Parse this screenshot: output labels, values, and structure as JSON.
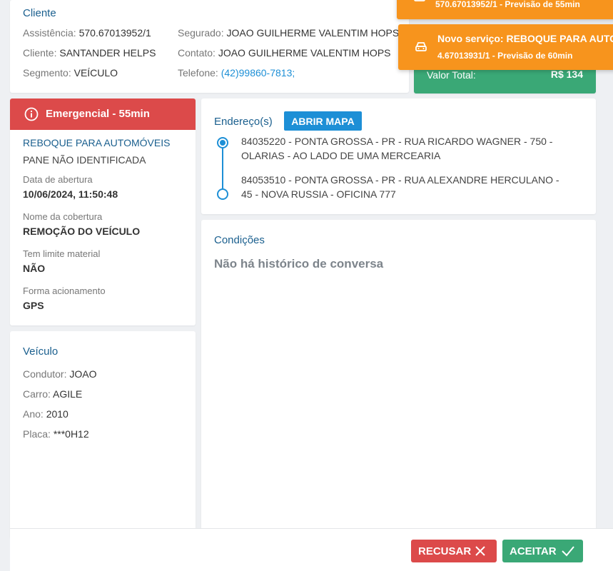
{
  "client": {
    "title": "Cliente",
    "assistencia_label": "Assistência:",
    "assistencia_value": "570.67013952/1",
    "cliente_label": "Cliente:",
    "cliente_value": "SANTANDER HELPS",
    "segmento_label": "Segmento:",
    "segmento_value": "VEÍCULO",
    "segurado_label": "Segurado:",
    "segurado_value": "JOAO GUILHERME VALENTIM HOPS",
    "contato_label": "Contato:",
    "contato_value": "JOAO GUILHERME VALENTIM HOPS",
    "telefone_label": "Telefone:",
    "telefone_value": "(42)99860-7813;"
  },
  "valor": {
    "label": "Valor Total:",
    "value": "R$ 134"
  },
  "notifications": [
    {
      "title": "",
      "subtitle": "570.67013952/1 - Previsão de 55min",
      "icon": "car-icon"
    },
    {
      "title": "Novo serviço: REBOQUE PARA AUTOMÓVEIS",
      "subtitle": "4.67013931/1 - Previsão de 60min",
      "icon": "car-icon"
    }
  ],
  "service": {
    "priority": "Emergencial - 55min",
    "title": "REBOQUE PARA AUTOMÓVEIS",
    "subtitle": "PANE NÃO IDENTIFICADA",
    "fields": [
      {
        "label": "Data de abertura",
        "value": "10/06/2024, 11:50:48"
      },
      {
        "label": "Nome da cobertura",
        "value": "REMOÇÃO DO VEÍCULO"
      },
      {
        "label": "Tem limite material",
        "value": "NÃO"
      },
      {
        "label": "Forma acionamento",
        "value": "GPS"
      }
    ]
  },
  "vehicle": {
    "title": "Veículo",
    "items": [
      {
        "label": "Condutor:",
        "value": "JOAO"
      },
      {
        "label": "Carro:",
        "value": "AGILE"
      },
      {
        "label": "Ano:",
        "value": "2010"
      },
      {
        "label": "Placa:",
        "value": "***0H12"
      }
    ]
  },
  "address": {
    "title": "Endereço(s)",
    "map_button": "ABRIR MAPA",
    "items": [
      "84035220 - PONTA GROSSA - PR - RUA RICARDO WAGNER - 750 - OLARIAS - AO LADO DE UMA MERCEARIA",
      "84053510 - PONTA GROSSA - PR - RUA ALEXANDRE HERCULANO - 45 - NOVA RUSSIA - OFICINA 777"
    ]
  },
  "conditions": {
    "title": "Condições",
    "empty": "Não há histórico de conversa"
  },
  "footer": {
    "reject": "RECUSAR",
    "accept": "ACEITAR"
  },
  "colors": {
    "accent_blue": "#1d8fd6",
    "title_blue": "#1a5f8e",
    "danger": "#dc4a4a",
    "success": "#3aa876",
    "warning": "#f7941d"
  }
}
